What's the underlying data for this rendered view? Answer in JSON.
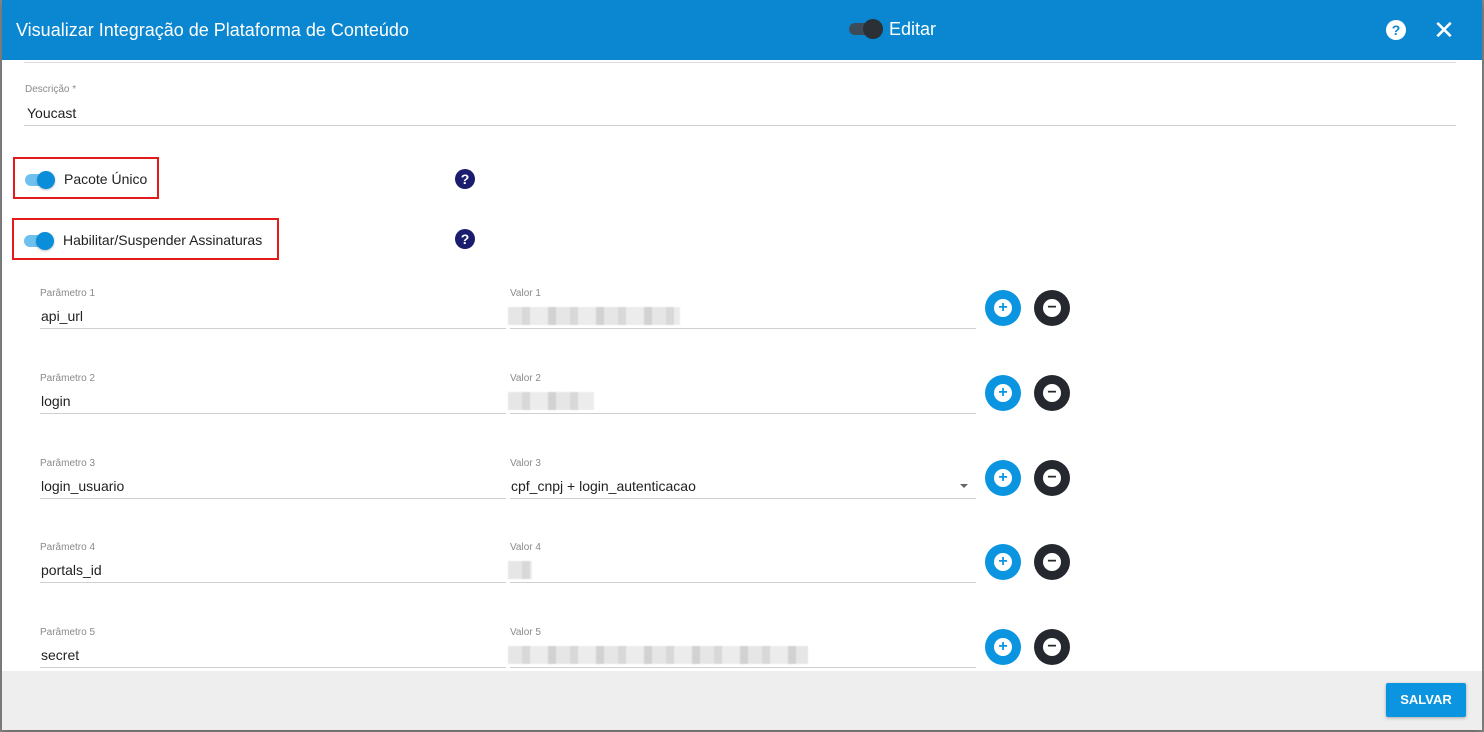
{
  "header": {
    "title": "Visualizar Integração de Plataforma de Conteúdo",
    "edit_label": "Editar",
    "help_icon": "?",
    "close_icon": "✕"
  },
  "description": {
    "label": "Descrição *",
    "value": "Youcast"
  },
  "toggles": [
    {
      "label": "Pacote Único",
      "checked": true,
      "help": "?"
    },
    {
      "label": "Habilitar/Suspender Assinaturas",
      "checked": true,
      "help": "?"
    }
  ],
  "params": [
    {
      "param_label": "Parâmetro 1",
      "param_value": "api_url",
      "value_label": "Valor 1",
      "value": ""
    },
    {
      "param_label": "Parâmetro 2",
      "param_value": "login",
      "value_label": "Valor 2",
      "value": ""
    },
    {
      "param_label": "Parâmetro 3",
      "param_value": "login_usuario",
      "value_label": "Valor 3",
      "value": "cpf_cnpj + login_autenticacao"
    },
    {
      "param_label": "Parâmetro 4",
      "param_value": "portals_id",
      "value_label": "Valor 4",
      "value": ""
    },
    {
      "param_label": "Parâmetro 5",
      "param_value": "secret",
      "value_label": "Valor 5",
      "value": ""
    }
  ],
  "buttons": {
    "plus": "+",
    "minus": "−"
  },
  "footer": {
    "save_label": "SALVAR"
  },
  "colors": {
    "header": "#0a87d0",
    "accent": "#0b95e0",
    "highlight_border": "#e31b1b",
    "dark_button": "#25292f"
  }
}
